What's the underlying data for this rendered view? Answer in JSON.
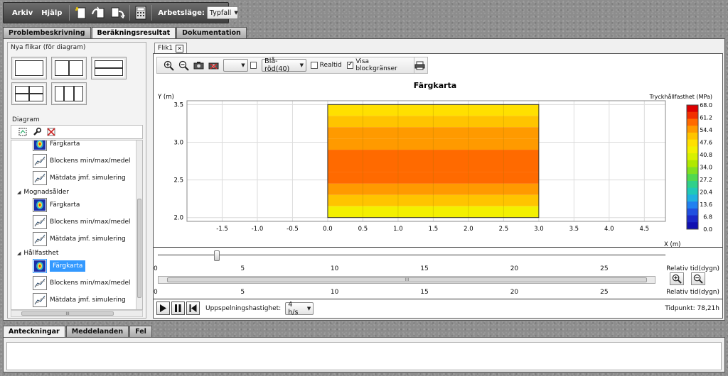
{
  "menu": {
    "file": "Arkiv",
    "help": "Hjälp",
    "mode_label": "Arbetsläge:",
    "mode_value": "Typfall"
  },
  "main_tabs": [
    {
      "label": "Problembeskrivning",
      "active": false
    },
    {
      "label": "Beräkningsresultat",
      "active": true
    },
    {
      "label": "Dokumentation",
      "active": false
    }
  ],
  "sidebar": {
    "layouts_title": "Nya flikar (för diagram)",
    "diagram_title": "Diagram",
    "tree": {
      "row1": "Färgkarta",
      "row2": "Blockens min/max/medel",
      "row3": "Mätdata jmf. simulering",
      "group2": "Mognadsålder",
      "row4": "Färgkarta",
      "row5": "Blockens min/max/medel",
      "row6": "Mätdata jmf. simulering",
      "group3": "Hållfasthet",
      "row7": "Färgkarta",
      "row8": "Blockens min/max/medel",
      "row9": "Mätdata jmf. simulering"
    },
    "hscroll_grip": "III"
  },
  "subtab": {
    "label": "Flik1",
    "close": "✕"
  },
  "chart_toolbar": {
    "palette_value": "Blå-röd(40)",
    "realtime_label": "Realtid",
    "show_bounds_label": "Visa blockgränser",
    "show_bounds_checked": true,
    "realtime_checked": false
  },
  "chart_data": {
    "type": "heatmap",
    "title": "Färgkarta",
    "xlabel": "X (m)",
    "ylabel": "Y (m)",
    "xlim": [
      -2.0,
      4.8
    ],
    "ylim": [
      1.95,
      3.55
    ],
    "xticks": [
      "-1.5",
      "-1.0",
      "-0.5",
      "0.0",
      "0.5",
      "1.0",
      "1.5",
      "2.0",
      "2.5",
      "3.0",
      "3.5",
      "4.0",
      "4.5"
    ],
    "xtick_values": [
      -1.5,
      -1.0,
      -0.5,
      0.0,
      0.5,
      1.0,
      1.5,
      2.0,
      2.5,
      3.0,
      3.5,
      4.0,
      4.5
    ],
    "yticks": [
      "2.0",
      "2.5",
      "3.0",
      "3.5"
    ],
    "ytick_values": [
      2.0,
      2.5,
      3.0,
      3.5
    ],
    "block": {
      "x0": 0.0,
      "x1": 3.0,
      "y0": 2.0,
      "y1": 3.5
    },
    "rows": [
      {
        "y0": 3.35,
        "y1": 3.5,
        "value": 47.0
      },
      {
        "y0": 3.2,
        "y1": 3.35,
        "value": 52.0
      },
      {
        "y0": 3.05,
        "y1": 3.2,
        "value": 54.0
      },
      {
        "y0": 2.9,
        "y1": 3.05,
        "value": 56.0
      },
      {
        "y0": 2.75,
        "y1": 2.9,
        "value": 58.0
      },
      {
        "y0": 2.6,
        "y1": 2.75,
        "value": 59.0
      },
      {
        "y0": 2.45,
        "y1": 2.6,
        "value": 57.0
      },
      {
        "y0": 2.3,
        "y1": 2.45,
        "value": 55.0
      },
      {
        "y0": 2.15,
        "y1": 2.3,
        "value": 51.0
      },
      {
        "y0": 2.0,
        "y1": 2.15,
        "value": 45.0
      }
    ],
    "colorbar": {
      "label": "Tryckhållfasthet (MPa)",
      "ticks": [
        "68.0",
        "61.2",
        "54.4",
        "47.6",
        "40.8",
        "34.0",
        "27.2",
        "20.4",
        "13.6",
        "6.8",
        "0.0"
      ],
      "min": 0.0,
      "max": 68.0,
      "colors": [
        "#dd0000",
        "#f23000",
        "#ff6a00",
        "#ff9a00",
        "#ffc400",
        "#ffe000",
        "#f3f000",
        "#d8f000",
        "#b0e800",
        "#80e020",
        "#50d850",
        "#30d08a",
        "#20c8b8",
        "#20b0e0",
        "#2080f0",
        "#2050e0",
        "#1a28c8",
        "#1010b0"
      ]
    }
  },
  "timeline": {
    "axis_label": "Relativ tid(dygn)",
    "ticks": [
      "0",
      "5",
      "10",
      "15",
      "20",
      "25"
    ],
    "tick_values": [
      0,
      5,
      10,
      15,
      20,
      25
    ],
    "max": 28,
    "slider_value": 3.25,
    "scroll_grip": "III",
    "speed_label": "Uppspelningshastighet:",
    "speed_value": "4 h/s",
    "time_point": "Tidpunkt: 78,21h"
  },
  "bottom_tabs": [
    {
      "label": "Anteckningar",
      "active": true
    },
    {
      "label": "Meddelanden",
      "active": false
    },
    {
      "label": "Fel",
      "active": false
    }
  ]
}
